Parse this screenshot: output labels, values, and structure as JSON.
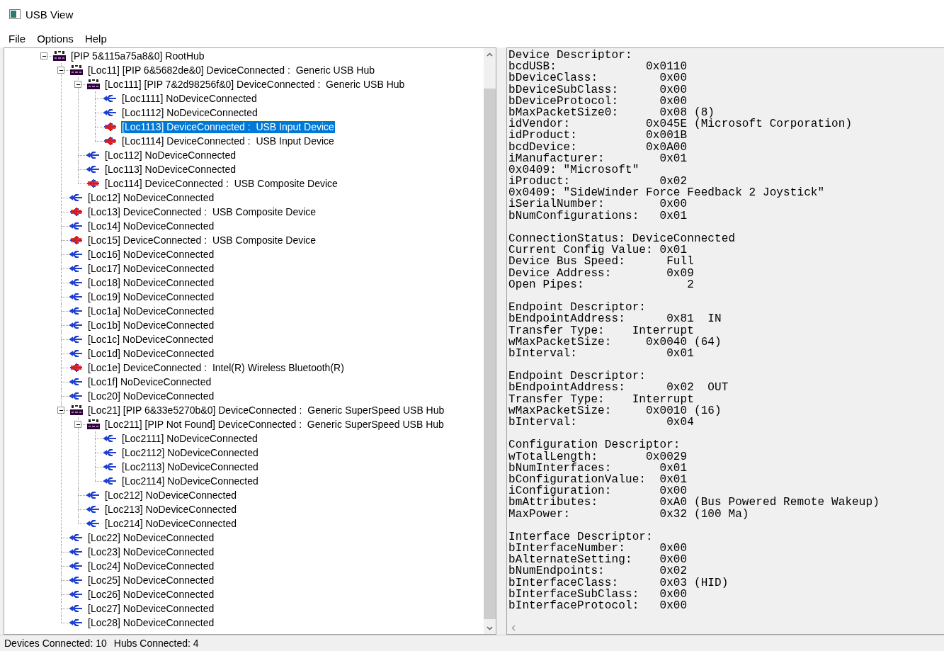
{
  "window": {
    "title": "USB View"
  },
  "menu": [
    {
      "label": "File"
    },
    {
      "label": "Options"
    },
    {
      "label": "Help"
    }
  ],
  "tree": [
    {
      "kind": "hub",
      "label": "[PIP 5&115a75a8&0] RootHub",
      "expanded": true,
      "selected": false,
      "children": [
        {
          "kind": "hub",
          "label": "[Loc11] [PIP 6&5682de&0] DeviceConnected :  Generic USB Hub",
          "expanded": true,
          "selected": false,
          "children": [
            {
              "kind": "hub",
              "label": "[Loc111] [PIP 7&2d98256f&0] DeviceConnected :  Generic USB Hub",
              "expanded": true,
              "selected": false,
              "children": [
                {
                  "kind": "port",
                  "label": "[Loc1111] NoDeviceConnected",
                  "selected": false
                },
                {
                  "kind": "port",
                  "label": "[Loc1112] NoDeviceConnected",
                  "selected": false
                },
                {
                  "kind": "device",
                  "label": "[Loc1113] DeviceConnected :  USB Input Device",
                  "selected": true
                },
                {
                  "kind": "device",
                  "label": "[Loc1114] DeviceConnected :  USB Input Device",
                  "selected": false
                }
              ]
            },
            {
              "kind": "port",
              "label": "[Loc112] NoDeviceConnected",
              "selected": false
            },
            {
              "kind": "port",
              "label": "[Loc113] NoDeviceConnected",
              "selected": false
            },
            {
              "kind": "device",
              "label": "[Loc114] DeviceConnected :  USB Composite Device",
              "selected": false
            }
          ]
        },
        {
          "kind": "port",
          "label": "[Loc12] NoDeviceConnected",
          "selected": false
        },
        {
          "kind": "device",
          "label": "[Loc13] DeviceConnected :  USB Composite Device",
          "selected": false
        },
        {
          "kind": "port",
          "label": "[Loc14] NoDeviceConnected",
          "selected": false
        },
        {
          "kind": "device",
          "label": "[Loc15] DeviceConnected :  USB Composite Device",
          "selected": false
        },
        {
          "kind": "port",
          "label": "[Loc16] NoDeviceConnected",
          "selected": false
        },
        {
          "kind": "port",
          "label": "[Loc17] NoDeviceConnected",
          "selected": false
        },
        {
          "kind": "port",
          "label": "[Loc18] NoDeviceConnected",
          "selected": false
        },
        {
          "kind": "port",
          "label": "[Loc19] NoDeviceConnected",
          "selected": false
        },
        {
          "kind": "port",
          "label": "[Loc1a] NoDeviceConnected",
          "selected": false
        },
        {
          "kind": "port",
          "label": "[Loc1b] NoDeviceConnected",
          "selected": false
        },
        {
          "kind": "port",
          "label": "[Loc1c] NoDeviceConnected",
          "selected": false
        },
        {
          "kind": "port",
          "label": "[Loc1d] NoDeviceConnected",
          "selected": false
        },
        {
          "kind": "device",
          "label": "[Loc1e] DeviceConnected :  Intel(R) Wireless Bluetooth(R)",
          "selected": false
        },
        {
          "kind": "port",
          "label": "[Loc1f] NoDeviceConnected",
          "selected": false
        },
        {
          "kind": "port",
          "label": "[Loc20] NoDeviceConnected",
          "selected": false
        },
        {
          "kind": "hub",
          "label": "[Loc21] [PIP 6&33e5270b&0] DeviceConnected :  Generic SuperSpeed USB Hub",
          "expanded": true,
          "selected": false,
          "children": [
            {
              "kind": "hub",
              "label": "[Loc211] [PIP Not Found] DeviceConnected :  Generic SuperSpeed USB Hub",
              "expanded": true,
              "selected": false,
              "children": [
                {
                  "kind": "port",
                  "label": "[Loc2111] NoDeviceConnected",
                  "selected": false
                },
                {
                  "kind": "port",
                  "label": "[Loc2112] NoDeviceConnected",
                  "selected": false
                },
                {
                  "kind": "port",
                  "label": "[Loc2113] NoDeviceConnected",
                  "selected": false
                },
                {
                  "kind": "port",
                  "label": "[Loc2114] NoDeviceConnected",
                  "selected": false
                }
              ]
            },
            {
              "kind": "port",
              "label": "[Loc212] NoDeviceConnected",
              "selected": false
            },
            {
              "kind": "port",
              "label": "[Loc213] NoDeviceConnected",
              "selected": false
            },
            {
              "kind": "port",
              "label": "[Loc214] NoDeviceConnected",
              "selected": false
            }
          ]
        },
        {
          "kind": "port",
          "label": "[Loc22] NoDeviceConnected",
          "selected": false
        },
        {
          "kind": "port",
          "label": "[Loc23] NoDeviceConnected",
          "selected": false
        },
        {
          "kind": "port",
          "label": "[Loc24] NoDeviceConnected",
          "selected": false
        },
        {
          "kind": "port",
          "label": "[Loc25] NoDeviceConnected",
          "selected": false
        },
        {
          "kind": "port",
          "label": "[Loc26] NoDeviceConnected",
          "selected": false
        },
        {
          "kind": "port",
          "label": "[Loc27] NoDeviceConnected",
          "selected": false
        },
        {
          "kind": "port",
          "label": "[Loc28] NoDeviceConnected",
          "selected": false
        }
      ]
    }
  ],
  "details": [
    [
      "Device Descriptor:",
      "bcdUSB:             0x0110",
      "bDeviceClass:         0x00",
      "bDeviceSubClass:      0x00",
      "bDeviceProtocol:      0x00",
      "bMaxPacketSize0:      0x08 (8)",
      "idVendor:           0x045E (Microsoft Corporation)",
      "idProduct:          0x001B",
      "bcdDevice:          0x0A00",
      "iManufacturer:        0x01",
      "0x0409: \"Microsoft\"",
      "iProduct:             0x02",
      "0x0409: \"SideWinder Force Feedback 2 Joystick\"",
      "iSerialNumber:        0x00",
      "bNumConfigurations:   0x01"
    ],
    [
      "ConnectionStatus: DeviceConnected",
      "Current Config Value: 0x01",
      "Device Bus Speed:      Full",
      "Device Address:        0x09",
      "Open Pipes:               2"
    ],
    [
      "Endpoint Descriptor:",
      "bEndpointAddress:      0x81  IN",
      "Transfer Type:    Interrupt",
      "wMaxPacketSize:     0x0040 (64)",
      "bInterval:             0x01"
    ],
    [
      "Endpoint Descriptor:",
      "bEndpointAddress:      0x02  OUT",
      "Transfer Type:    Interrupt",
      "wMaxPacketSize:     0x0010 (16)",
      "bInterval:             0x04"
    ],
    [
      "Configuration Descriptor:",
      "wTotalLength:       0x0029",
      "bNumInterfaces:       0x01",
      "bConfigurationValue:  0x01",
      "iConfiguration:       0x00",
      "bmAttributes:         0xA0 (Bus Powered Remote Wakeup)",
      "MaxPower:             0x32 (100 Ma)"
    ],
    [
      "Interface Descriptor:",
      "bInterfaceNumber:     0x00",
      "bAlternateSetting:    0x00",
      "bNumEndpoints:        0x02",
      "bInterfaceClass:      0x03 (HID)",
      "bInterfaceSubClass:   0x00",
      "bInterfaceProtocol:   0x00"
    ]
  ],
  "status_bar": [
    "Devices Connected: 10",
    "Hubs Connected: 4"
  ]
}
